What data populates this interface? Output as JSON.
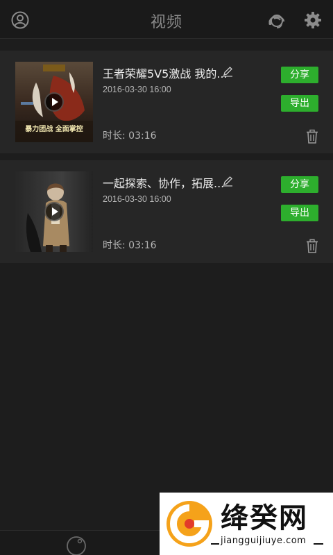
{
  "header": {
    "title": "视频",
    "icons": [
      "user-icon",
      "customer-service-icon",
      "gear-icon"
    ]
  },
  "videos": [
    {
      "title": "王者荣耀5V5激战 我的...",
      "date": "2016-03-30  16:00",
      "duration": "时长: 03:16",
      "share_label": "分享",
      "export_label": "导出",
      "thumb_caption": "暴力团战 全面掌控"
    },
    {
      "title": "一起探索、协作，拓展...",
      "date": "2016-03-30  16:00",
      "duration": "时长: 03:16",
      "share_label": "分享",
      "export_label": "导出"
    }
  ],
  "watermark": {
    "name": "绛癸网",
    "url": "jiangguijiuye.com"
  },
  "colors": {
    "background": "#1d1d1d",
    "card": "#262626",
    "accent_green": "#2dae2d",
    "title_gray": "#8a8a8a"
  }
}
